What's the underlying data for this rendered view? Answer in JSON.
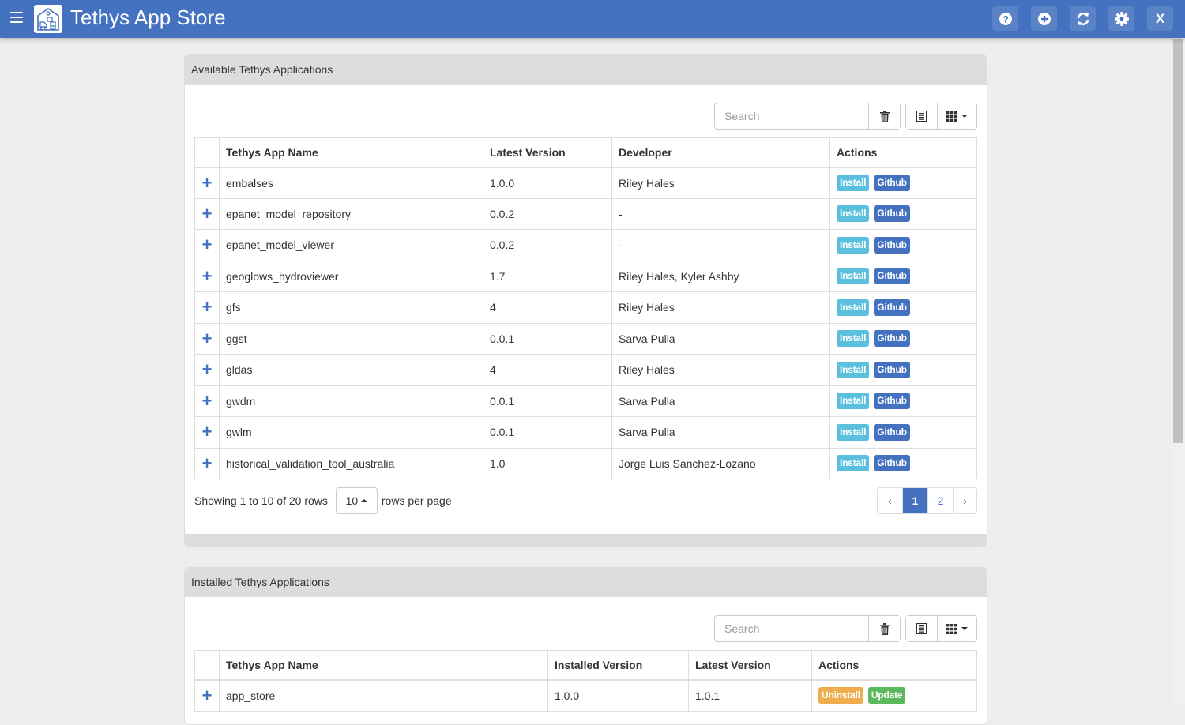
{
  "header": {
    "title": "Tethys App Store",
    "buttons": [
      {
        "name": "help-button",
        "icon": "question-circle-icon"
      },
      {
        "name": "add-button",
        "icon": "plus-circle-icon"
      },
      {
        "name": "refresh-button",
        "icon": "refresh-icon"
      },
      {
        "name": "settings-button",
        "icon": "gear-icon"
      },
      {
        "name": "close-button",
        "icon": "close-icon",
        "label": "X"
      }
    ]
  },
  "colors": {
    "brand": "#4472c0",
    "install": "#5bc0de",
    "github": "#4472c0",
    "uninstall": "#f0ad4e",
    "update": "#5cb85c"
  },
  "available": {
    "title": "Available Tethys Applications",
    "search_placeholder": "Search",
    "columns": [
      "Tethys App Name",
      "Latest Version",
      "Developer",
      "Actions"
    ],
    "rows": [
      {
        "name": "embalses",
        "version": "1.0.0",
        "developer": "Riley Hales"
      },
      {
        "name": "epanet_model_repository",
        "version": "0.0.2",
        "developer": "-"
      },
      {
        "name": "epanet_model_viewer",
        "version": "0.0.2",
        "developer": "-"
      },
      {
        "name": "geoglows_hydroviewer",
        "version": "1.7",
        "developer": "Riley Hales, Kyler Ashby"
      },
      {
        "name": "gfs",
        "version": "4",
        "developer": "Riley Hales"
      },
      {
        "name": "ggst",
        "version": "0.0.1",
        "developer": "Sarva Pulla"
      },
      {
        "name": "gldas",
        "version": "4",
        "developer": "Riley Hales"
      },
      {
        "name": "gwdm",
        "version": "0.0.1",
        "developer": "Sarva Pulla"
      },
      {
        "name": "gwlm",
        "version": "0.0.1",
        "developer": "Sarva Pulla"
      },
      {
        "name": "historical_validation_tool_australia",
        "version": "1.0",
        "developer": "Jorge Luis Sanchez-Lozano"
      }
    ],
    "install_label": "Install",
    "github_label": "Github",
    "pagination": {
      "showing": "Showing 1 to 10 of 20 rows",
      "page_size": "10",
      "rows_per_page": "rows per page",
      "prev": "‹",
      "pages": [
        "1",
        "2"
      ],
      "active_page": "1",
      "next": "›"
    }
  },
  "installed": {
    "title": "Installed Tethys Applications",
    "search_placeholder": "Search",
    "columns": [
      "Tethys App Name",
      "Installed Version",
      "Latest Version",
      "Actions"
    ],
    "rows": [
      {
        "name": "app_store",
        "installed": "1.0.0",
        "latest": "1.0.1"
      }
    ],
    "uninstall_label": "Uninstall",
    "update_label": "Update"
  }
}
